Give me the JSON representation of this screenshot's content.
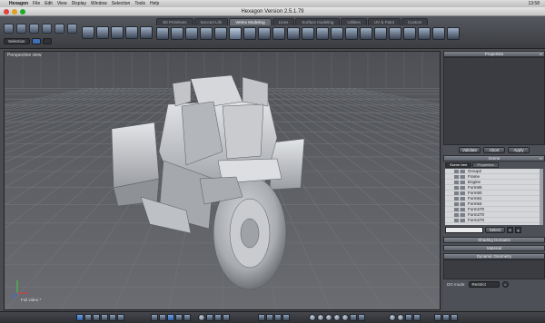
{
  "menubar": {
    "items": [
      "Hexagon",
      "File",
      "Edit",
      "View",
      "Display",
      "Window",
      "Selection",
      "Tools",
      "Help"
    ],
    "clock": "13:58"
  },
  "window": {
    "title": "Hexagon Version 2.5.1.79"
  },
  "toolbar": {
    "tabs": [
      "3D Primitives",
      "Second Life",
      "Vertex Modeling",
      "Lines",
      "Surface modeling",
      "Utilities",
      "UV & Paint",
      "Custom"
    ],
    "active_tab": "Vertex Modeling",
    "selection_label": "Selection",
    "loop_labels": [
      "LOOP",
      "RING",
      "INTMO"
    ],
    "camera_label": "CAMERA"
  },
  "viewport": {
    "label": "Perspective view",
    "footer": "Full video *"
  },
  "properties_panel": {
    "title": "Properties",
    "buttons": [
      "Validate",
      "Abort",
      "Apply"
    ]
  },
  "scene_panel": {
    "title": "Scene",
    "tabs": [
      "Scene tree",
      "Properties"
    ],
    "active_tab": "Scene tree",
    "items": [
      "Group2",
      "Frame",
      "Engine",
      "Form65",
      "Form50",
      "Form61",
      "Form64",
      "Form270",
      "Form270",
      "Form270"
    ],
    "select_label": "Select"
  },
  "collapsed_panels": [
    "Shading Domains",
    "Material",
    "Dynamic Geometry"
  ],
  "dg_mode": {
    "label": "DG mode:",
    "value": "Restrict"
  },
  "colors": {
    "accent": "#3f6fb5",
    "viewport_bg": "#5b5d62",
    "grid_line": "#6f7277"
  }
}
